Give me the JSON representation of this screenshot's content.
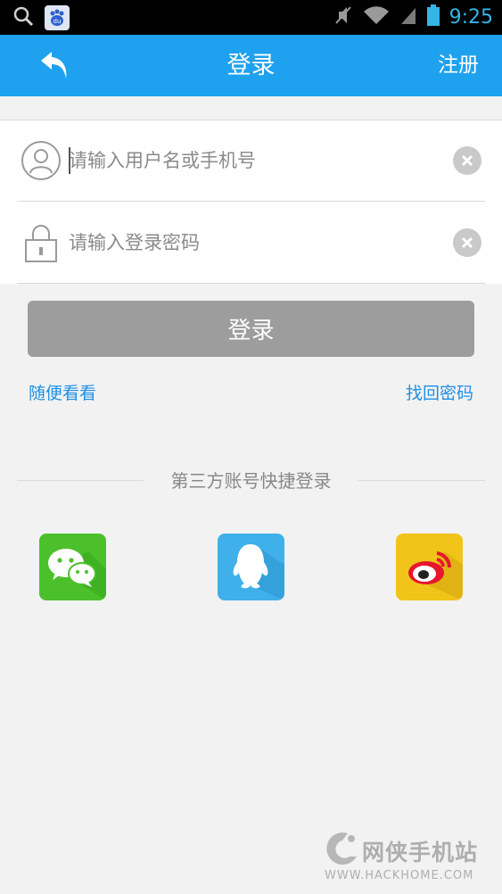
{
  "status_bar": {
    "time": "9:25",
    "icons": [
      "search-icon",
      "baidu-icon",
      "mute-icon",
      "wifi-icon",
      "signal-icon",
      "battery-icon"
    ]
  },
  "title_bar": {
    "title": "登录",
    "register_label": "注册",
    "color": "#1ea1ee"
  },
  "form": {
    "username_placeholder": "请输入用户名或手机号",
    "password_placeholder": "请输入登录密码"
  },
  "login_button": {
    "label": "登录",
    "color": "#9d9d9d"
  },
  "links": {
    "browse": "随便看看",
    "forgot_password": "找回密码"
  },
  "third_party": {
    "heading": "第三方账号快捷登录",
    "providers": [
      "wechat",
      "qq",
      "weibo"
    ]
  },
  "watermark": {
    "cn": "网侠手机站",
    "en": "WWW.HACKHOME.COM"
  }
}
